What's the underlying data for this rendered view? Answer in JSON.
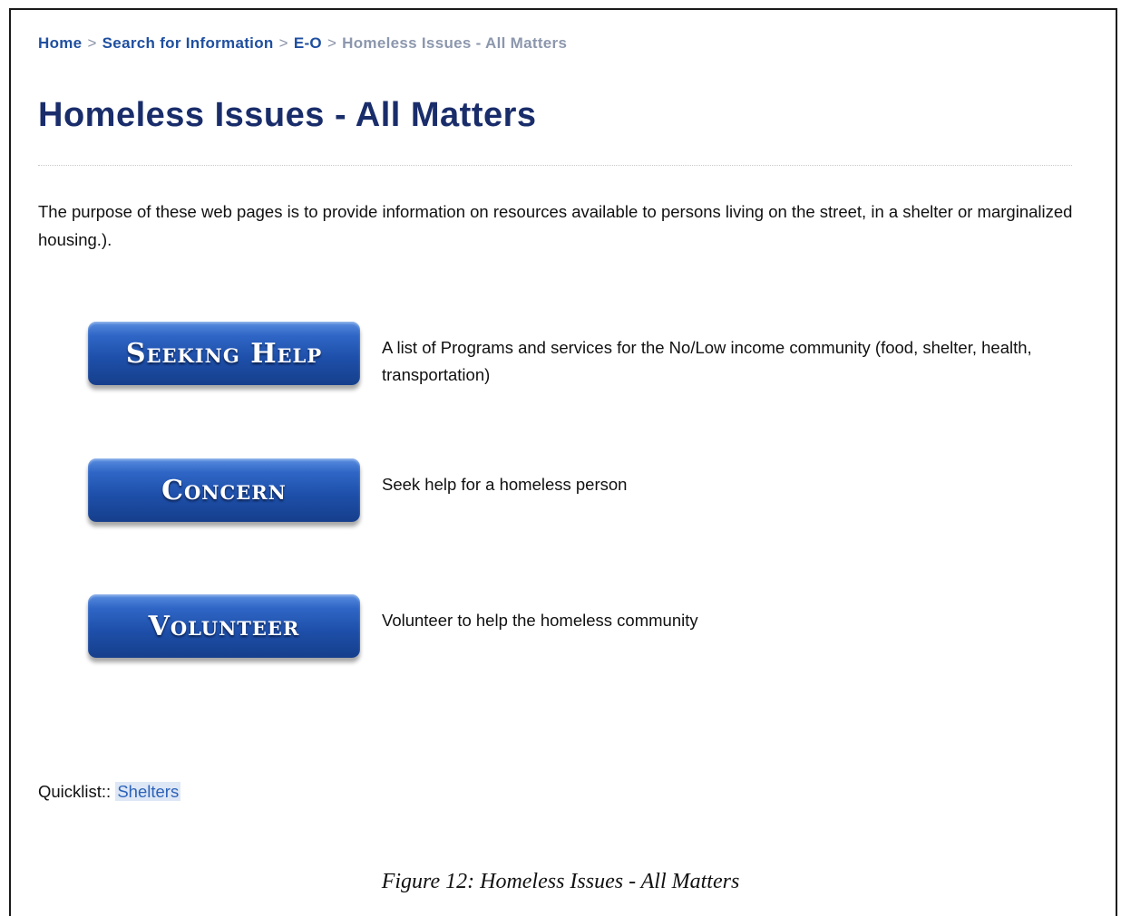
{
  "breadcrumb": {
    "items": [
      "Home",
      "Search for Information",
      "E-O"
    ],
    "separator": ">",
    "current": "Homeless Issues - All Matters"
  },
  "page": {
    "title": "Homeless Issues - All Matters",
    "intro": "The purpose of these web pages is to provide information on resources available to persons living on the street, in a shelter or marginalized housing.)."
  },
  "actions": [
    {
      "label": "Seeking Help",
      "description": "A list of Programs and services for the No/Low income community (food, shelter, health, transportation)"
    },
    {
      "label": "Concern",
      "description": "Seek help for a homeless person"
    },
    {
      "label": "Volunteer",
      "description": "Volunteer to help the homeless community"
    }
  ],
  "quicklist": {
    "label": "Quicklist::",
    "link": "Shelters"
  },
  "caption": "Figure 12: Homeless Issues - All Matters",
  "colors": {
    "title": "#1a2d6b",
    "link": "#1f4fa0",
    "button": "#1d4ea8"
  }
}
